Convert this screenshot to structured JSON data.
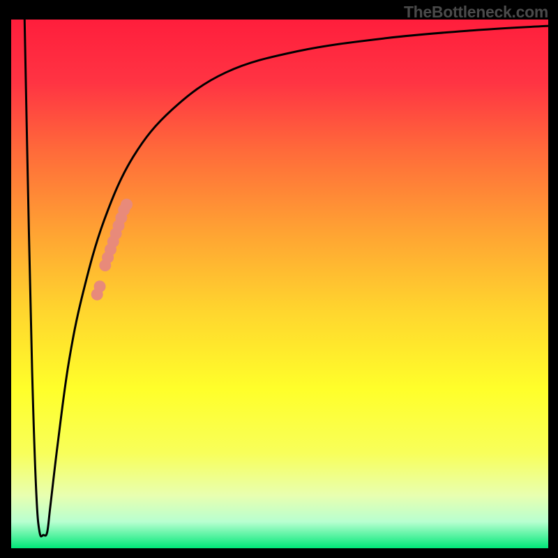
{
  "watermark": "TheBottleneck.com",
  "chart_data": {
    "type": "line",
    "title": "",
    "xlabel": "",
    "ylabel": "",
    "xlim": [
      0,
      100
    ],
    "ylim": [
      0,
      100
    ],
    "background": {
      "type": "vertical-gradient",
      "stops": [
        {
          "pos": 0.0,
          "color": "#ff1e3c"
        },
        {
          "pos": 0.12,
          "color": "#ff3443"
        },
        {
          "pos": 0.25,
          "color": "#ff6b3a"
        },
        {
          "pos": 0.4,
          "color": "#ffa233"
        },
        {
          "pos": 0.55,
          "color": "#ffd52e"
        },
        {
          "pos": 0.7,
          "color": "#ffff2a"
        },
        {
          "pos": 0.82,
          "color": "#f8ff5a"
        },
        {
          "pos": 0.9,
          "color": "#e8ffb0"
        },
        {
          "pos": 0.95,
          "color": "#b8ffd0"
        },
        {
          "pos": 1.0,
          "color": "#00e878"
        }
      ]
    },
    "series": [
      {
        "name": "bottleneck-curve",
        "color": "#000000",
        "points": [
          {
            "x": 2.5,
            "y": 100
          },
          {
            "x": 3.3,
            "y": 60
          },
          {
            "x": 4.0,
            "y": 30
          },
          {
            "x": 4.7,
            "y": 10
          },
          {
            "x": 5.3,
            "y": 3
          },
          {
            "x": 6.0,
            "y": 2.5
          },
          {
            "x": 6.7,
            "y": 3
          },
          {
            "x": 7.3,
            "y": 8
          },
          {
            "x": 8.7,
            "y": 20
          },
          {
            "x": 10.7,
            "y": 35
          },
          {
            "x": 13.3,
            "y": 48
          },
          {
            "x": 17.3,
            "y": 62
          },
          {
            "x": 22.7,
            "y": 74
          },
          {
            "x": 30.0,
            "y": 83
          },
          {
            "x": 40.0,
            "y": 90
          },
          {
            "x": 53.3,
            "y": 94
          },
          {
            "x": 70.0,
            "y": 96.5
          },
          {
            "x": 86.7,
            "y": 98
          },
          {
            "x": 100.0,
            "y": 98.8
          }
        ]
      }
    ],
    "highlight": {
      "name": "selected-range",
      "color": "#e88a7a",
      "points": [
        {
          "x": 16.0,
          "y": 48.0
        },
        {
          "x": 16.5,
          "y": 49.5
        },
        {
          "x": 17.5,
          "y": 53.5
        },
        {
          "x": 18.0,
          "y": 55.0
        },
        {
          "x": 18.5,
          "y": 56.5
        },
        {
          "x": 19.0,
          "y": 58.0
        },
        {
          "x": 19.5,
          "y": 59.5
        },
        {
          "x": 20.0,
          "y": 61.0
        },
        {
          "x": 20.5,
          "y": 62.5
        },
        {
          "x": 21.0,
          "y": 64.0
        },
        {
          "x": 21.5,
          "y": 65.0
        }
      ]
    }
  }
}
